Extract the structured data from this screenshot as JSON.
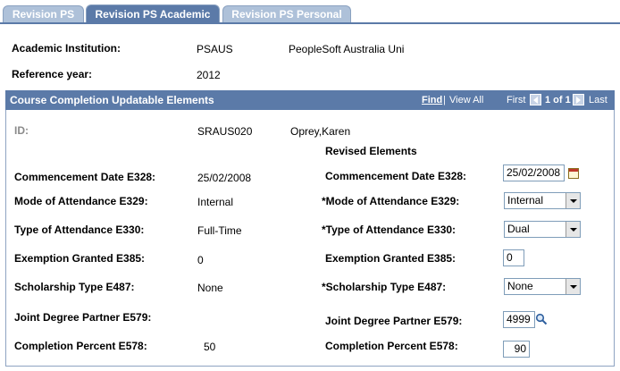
{
  "tabs": [
    {
      "label": "Revision PS",
      "active": false
    },
    {
      "label": "Revision PS Academic",
      "active": true
    },
    {
      "label": "Revision PS Personal",
      "active": false
    }
  ],
  "header": {
    "institution_label": "Academic Institution:",
    "institution_code": "PSAUS",
    "institution_name": "PeopleSoft Australia Uni",
    "year_label": "Reference year:",
    "year_value": "2012"
  },
  "grid": {
    "title": "Course Completion Updatable Elements",
    "find": "Find",
    "separator": "|",
    "view_all": "View All",
    "first": "First",
    "counter": "1 of 1",
    "last": "Last"
  },
  "record": {
    "id_label": "ID:",
    "id_value": "SRAUS020",
    "name": "Oprey,Karen",
    "revised_heading": "Revised Elements",
    "rows": [
      {
        "label": "Commencement Date E328:",
        "value": "25/02/2008",
        "rev_label": "Commencement Date E328:",
        "rev_value": "25/02/2008"
      },
      {
        "label": "Mode of Attendance E329:",
        "value": "Internal",
        "rev_label": "*Mode of Attendance E329:",
        "rev_value": "Internal"
      },
      {
        "label": "Type of Attendance E330:",
        "value": "Full-Time",
        "rev_label": "*Type of Attendance E330:",
        "rev_value": "Dual"
      },
      {
        "label": "Exemption Granted E385:",
        "value": "0",
        "rev_label": "Exemption Granted E385:",
        "rev_value": "0"
      },
      {
        "label": "Scholarship Type E487:",
        "value": "None",
        "rev_label": "*Scholarship Type E487:",
        "rev_value": "None"
      },
      {
        "label": "Joint Degree Partner E579:",
        "value": "",
        "rev_label": "Joint Degree Partner E579:",
        "rev_value": "4999"
      },
      {
        "label": "Completion Percent E578:",
        "value": "50",
        "rev_label": "Completion Percent E578:",
        "rev_value": "90"
      }
    ]
  },
  "colors": {
    "tab_active": "#5b7aa8",
    "tab_inactive": "#aec1d9",
    "grid_header": "#5b7aa8"
  }
}
